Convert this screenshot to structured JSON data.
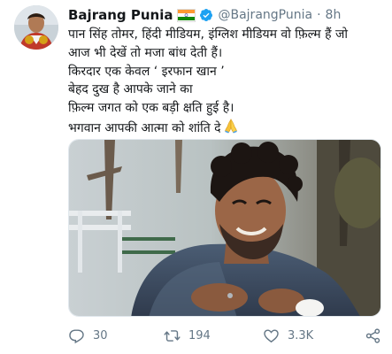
{
  "tweet": {
    "author": {
      "name": "Bajrang Punia",
      "handle": "@BajrangPunia",
      "separator": "·",
      "time": "8h"
    },
    "text_lines": [
      "पान सिंह तोमर, हिंदी मीडियम, इंग्लिश मीडियम वो फ़िल्म हैं जो",
      "आज भी देखें तो मजा बांध देती हैं।",
      "किरदार एक केवल ‘ इरफान खान ’",
      "बेहद दुख है आपके जाने का",
      "फ़िल्म जगत को एक बड़ी क्षति हुई है।",
      "भगवान आपकी आत्मा को शांति दे"
    ],
    "stats": {
      "replies": "30",
      "retweets": "194",
      "likes": "3.3K"
    }
  },
  "icons": {
    "flag": "india-flag-icon",
    "verified": "verified-badge-icon",
    "emoji": "folded-hands-emoji",
    "reply": "reply-icon",
    "retweet": "retweet-icon",
    "like": "heart-icon",
    "share": "share-icon"
  },
  "colors": {
    "name": "#14171a",
    "muted": "#657786",
    "verified": "#1da1f2"
  }
}
